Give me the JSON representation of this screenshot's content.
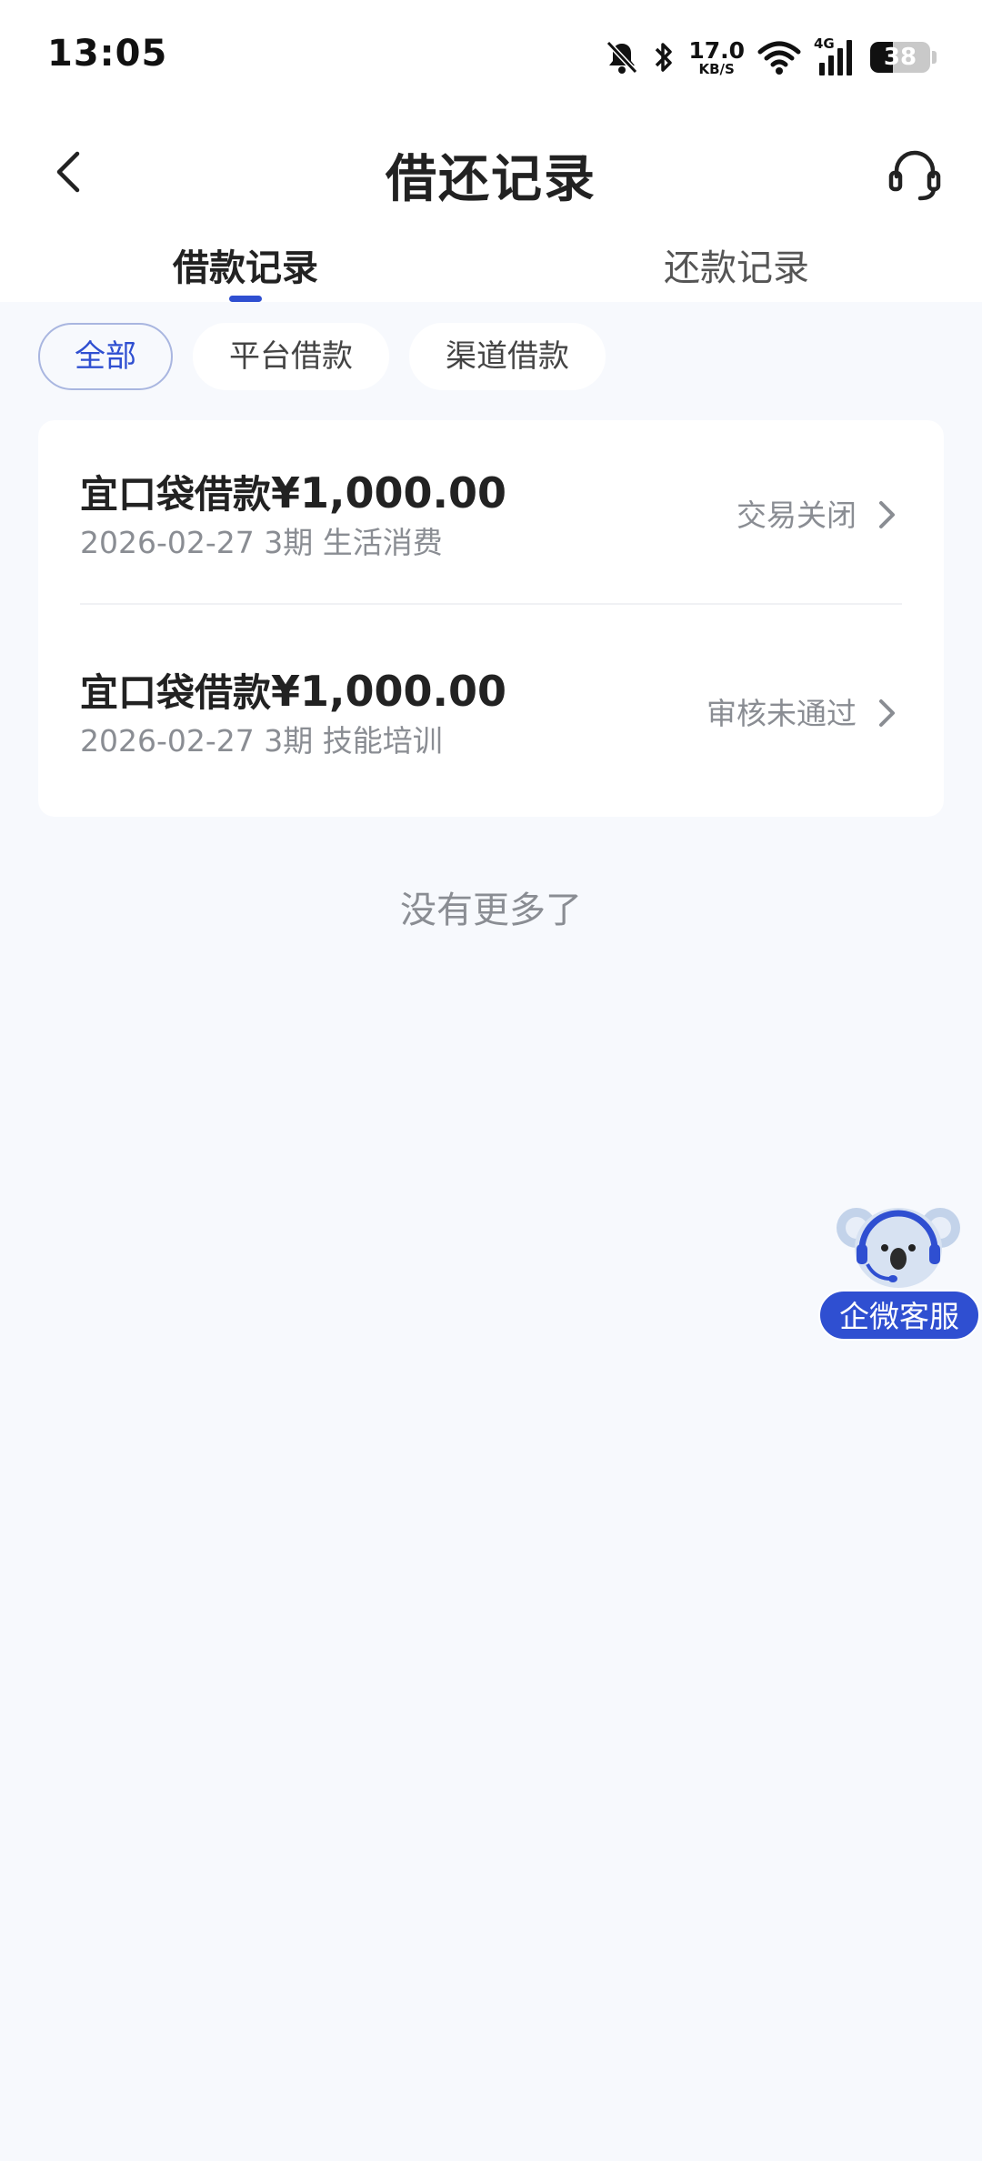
{
  "status_bar": {
    "time": "13:05",
    "net_speed_value": "17.0",
    "net_speed_unit": "KB/S",
    "network_type": "4G",
    "battery_level": "38",
    "icons": [
      "mute-bell-icon",
      "bluetooth-icon",
      "wifi-icon",
      "cellular-signal-icon",
      "battery-icon"
    ]
  },
  "nav": {
    "title": "借还记录",
    "back_icon": "chevron-left-icon",
    "service_icon": "headset-icon"
  },
  "tabs": [
    {
      "label": "借款记录",
      "active": true
    },
    {
      "label": "还款记录",
      "active": false
    }
  ],
  "filters": [
    {
      "label": "全部",
      "active": true
    },
    {
      "label": "平台借款",
      "active": false
    },
    {
      "label": "渠道借款",
      "active": false
    }
  ],
  "records": [
    {
      "title": "宜口袋借款",
      "amount": "¥1,000.00",
      "subtitle": "2026-02-27 3期  生活消费",
      "status": "交易关闭"
    },
    {
      "title": "宜口袋借款",
      "amount": "¥1,000.00",
      "subtitle": "2026-02-27 3期  技能培训",
      "status": "审核未通过"
    }
  ],
  "no_more_text": "没有更多了",
  "float_service": {
    "label": "企微客服",
    "icon": "koala-mascot-icon"
  },
  "colors": {
    "accent": "#2f4fd1",
    "background": "#f7f9fd",
    "muted_text": "#8a8d93"
  }
}
